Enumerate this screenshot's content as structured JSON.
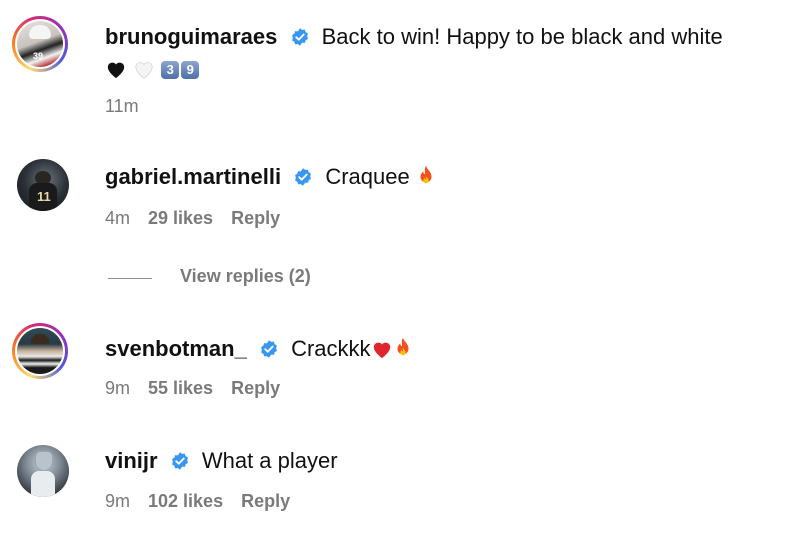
{
  "comments": [
    {
      "username": "brunoguimaraes",
      "text": "Back to win! Happy to be black and white",
      "text_line2_emoji": [
        "black-heart",
        "white-heart"
      ],
      "keycaps": [
        "3",
        "9"
      ],
      "time": "11m",
      "likes": "",
      "reply": ""
    },
    {
      "username": "gabriel.martinelli",
      "text": "Craquee",
      "emoji": "fire",
      "time": "4m",
      "likes": "29 likes",
      "reply": "Reply"
    },
    {
      "username": "svenbotman_",
      "text": "Crackkk",
      "emoji": [
        "red-heart",
        "fire"
      ],
      "time": "9m",
      "likes": "55 likes",
      "reply": "Reply"
    },
    {
      "username": "vinijr",
      "text": "What a player",
      "time": "9m",
      "likes": "102 likes",
      "reply": "Reply"
    }
  ],
  "view_replies": "View replies (2)",
  "colors": {
    "verified": "#3897f0",
    "meta": "#7a7a7a"
  }
}
